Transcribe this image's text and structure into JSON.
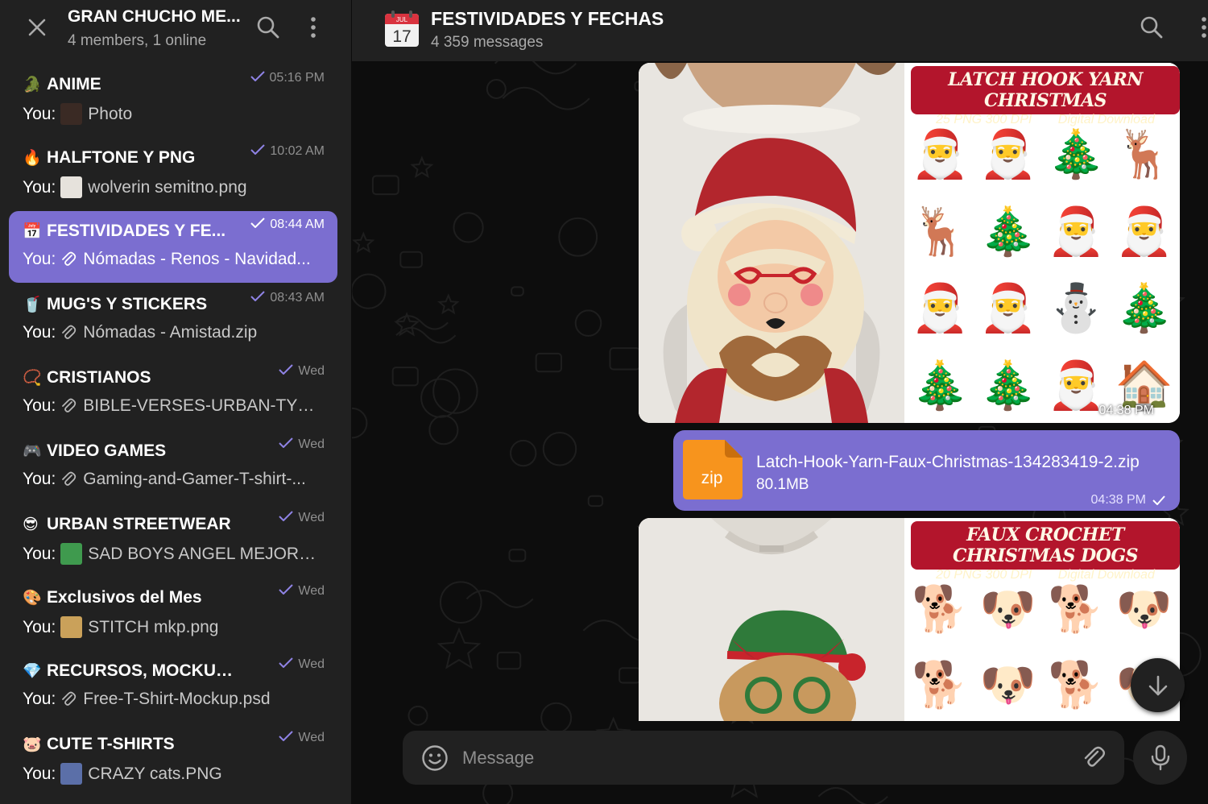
{
  "group": {
    "title": "GRAN CHUCHO ME...",
    "subtitle": "4 members, 1 online"
  },
  "chats": [
    {
      "emoji": "🐊",
      "title": "ANIME",
      "time": "05:16 PM",
      "you": "You:",
      "attach": "photo",
      "text": "Photo",
      "thumb_color": "#3a2a24"
    },
    {
      "emoji": "🔥",
      "title": "HALFTONE Y PNG",
      "time": "10:02 AM",
      "you": "You:",
      "attach": "photo",
      "text": "wolverin semitno.png",
      "thumb_color": "#e6e2dc"
    },
    {
      "emoji": "📅",
      "title": "FESTIVIDADES Y FE...",
      "time": "08:44 AM",
      "you": "You:",
      "attach": "file",
      "text": "Nómadas - Renos - Navidad...",
      "active": true
    },
    {
      "emoji": "🥤",
      "title": "MUG'S Y STICKERS",
      "time": "08:43 AM",
      "you": "You:",
      "attach": "file",
      "text": "Nómadas - Amistad.zip"
    },
    {
      "emoji": "📿",
      "title": "CRISTIANOS",
      "time": "Wed",
      "you": "You:",
      "attach": "file",
      "text": "BIBLE-VERSES-URBAN-TYP..."
    },
    {
      "emoji": "🎮",
      "title": "VIDEO GAMES",
      "time": "Wed",
      "you": "You:",
      "attach": "file",
      "text": "Gaming-and-Gamer-T-shirt-..."
    },
    {
      "emoji": "😎",
      "title": "URBAN STREETWEAR",
      "time": "Wed",
      "you": "You:",
      "attach": "photo",
      "text": "SAD BOYS ANGEL MEJORA...",
      "thumb_color": "#3f9a4e"
    },
    {
      "emoji": "🎨",
      "title": "Exclusivos del Mes",
      "time": "Wed",
      "you": "You:",
      "attach": "photo",
      "text": "STITCH mkp.png",
      "thumb_color": "#caa15a"
    },
    {
      "emoji": "💎",
      "title": "RECURSOS, MOCKUPS Y...",
      "time": "Wed",
      "you": "You:",
      "attach": "file",
      "text": "Free-T-Shirt-Mockup.psd"
    },
    {
      "emoji": "🐷",
      "title": "CUTE T-SHIRTS",
      "time": "Wed",
      "you": "You:",
      "attach": "photo",
      "text": "CRAZY cats.PNG",
      "thumb_color": "#5b6fa8"
    }
  ],
  "channel": {
    "calendar_month": "JUL",
    "calendar_day": "17",
    "title": "FESTIVIDADES Y FECHAS",
    "subtitle": "4 359 messages"
  },
  "messages": {
    "media1": {
      "banner_title": "LATCH HOOK YARN CHRISTMAS",
      "banner_left": "25 PNG 300 DPI",
      "banner_right": "Digital Download",
      "time": "04:38 PM",
      "designs": [
        "🎅",
        "🎅",
        "🎄",
        "🦌",
        "🦌",
        "🎄",
        "🎅",
        "🎅",
        "🎅",
        "🎅",
        "⛄",
        "🎄",
        "🎄",
        "🎄",
        "🎅",
        "🏠"
      ]
    },
    "file": {
      "ext": "zip",
      "name": "Latch-Hook-Yarn-Faux-Christmas-134283419-2.zip",
      "size": "80.1MB",
      "time": "04:38 PM"
    },
    "media2": {
      "banner_title": "FAUX CROCHET CHRISTMAS DOGS",
      "banner_left": "20 PNG 300 DPI",
      "banner_right": "Digital Download",
      "designs": [
        "🐕",
        "🐶",
        "🐕",
        "🐶",
        "🐕",
        "🐶",
        "🐕",
        "🐶"
      ]
    }
  },
  "composer": {
    "placeholder": "Message"
  },
  "colors": {
    "accent": "#7b6ed0",
    "panel": "#212121",
    "background": "#0d0d0d",
    "banner_red": "#b3152c",
    "zip_orange": "#f7941d"
  }
}
